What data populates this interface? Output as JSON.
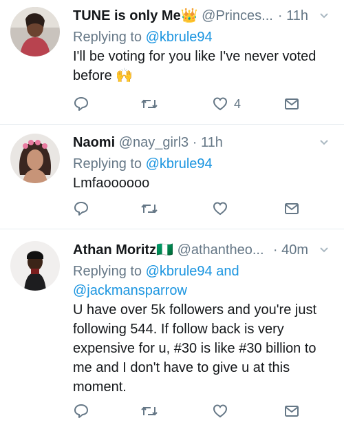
{
  "tweets": [
    {
      "name": "TUNE is only Me",
      "name_emoji": "👑",
      "handle": "@Princes...",
      "separator": "·",
      "time": "11h",
      "reply_prefix": "Replying to",
      "reply_to": "@kbrule94",
      "text": "I'll be voting for you like I've never voted before",
      "text_emoji": "🙌",
      "likes": "4"
    },
    {
      "name": "Naomi",
      "handle": "@nay_girl3",
      "separator": "·",
      "time": "11h",
      "reply_prefix": "Replying to",
      "reply_to": "@kbrule94",
      "text": "Lmfaoooooo"
    },
    {
      "name": "Athan Moritz",
      "name_emoji": "🇳🇬",
      "handle": "@athantheo...",
      "separator": "·",
      "time": "40m",
      "reply_prefix": "Replying to",
      "reply_to": "@kbrule94",
      "reply_and": "and",
      "reply_to_2": "@jackmansparrow",
      "text": "U have over 5k followers and you're just following 544. If follow back is very expensive for u, #30 is like #30 billion to me and I don't have to give u at this moment."
    }
  ],
  "icons": {
    "reply": "reply-icon",
    "retweet": "retweet-icon",
    "like": "heart-icon",
    "message": "envelope-icon",
    "caret": "chevron-down-icon"
  },
  "colors": {
    "link": "#1b95e0",
    "secondary": "#657786",
    "divider": "#e6ecf0"
  }
}
